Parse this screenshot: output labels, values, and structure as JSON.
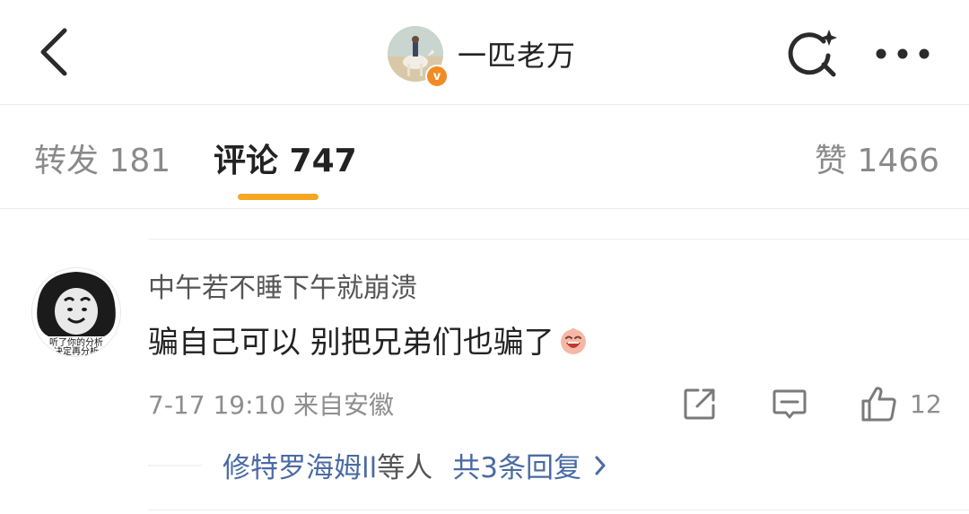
{
  "header": {
    "title": "一匹老万",
    "verified_badge": "v",
    "icons": {
      "back": "back-arrow-icon",
      "search": "search-sparkle-icon",
      "more": "more-dots-icon"
    }
  },
  "tabs": [
    {
      "label": "转发 181",
      "active": false
    },
    {
      "label": "评论 747",
      "active": true
    },
    {
      "label": "赞 1466",
      "active": false
    }
  ],
  "comment": {
    "username": "中午若不睡下午就崩溃",
    "avatar_caption_1": "听了你的分析",
    "avatar_caption_2": "决定再分析",
    "text": "骗自己可以 别把兄弟们也骗了",
    "emoji": "laughing-emoji",
    "meta": "7-17 19:10  来自安徽",
    "like_count": "12",
    "reply": {
      "users": "修特罗海姆ll",
      "etc": "等人",
      "total": "共3条回复"
    }
  },
  "colors": {
    "accent": "#f5a623",
    "link": "#4a6aa5",
    "badge": "#f28b24"
  }
}
